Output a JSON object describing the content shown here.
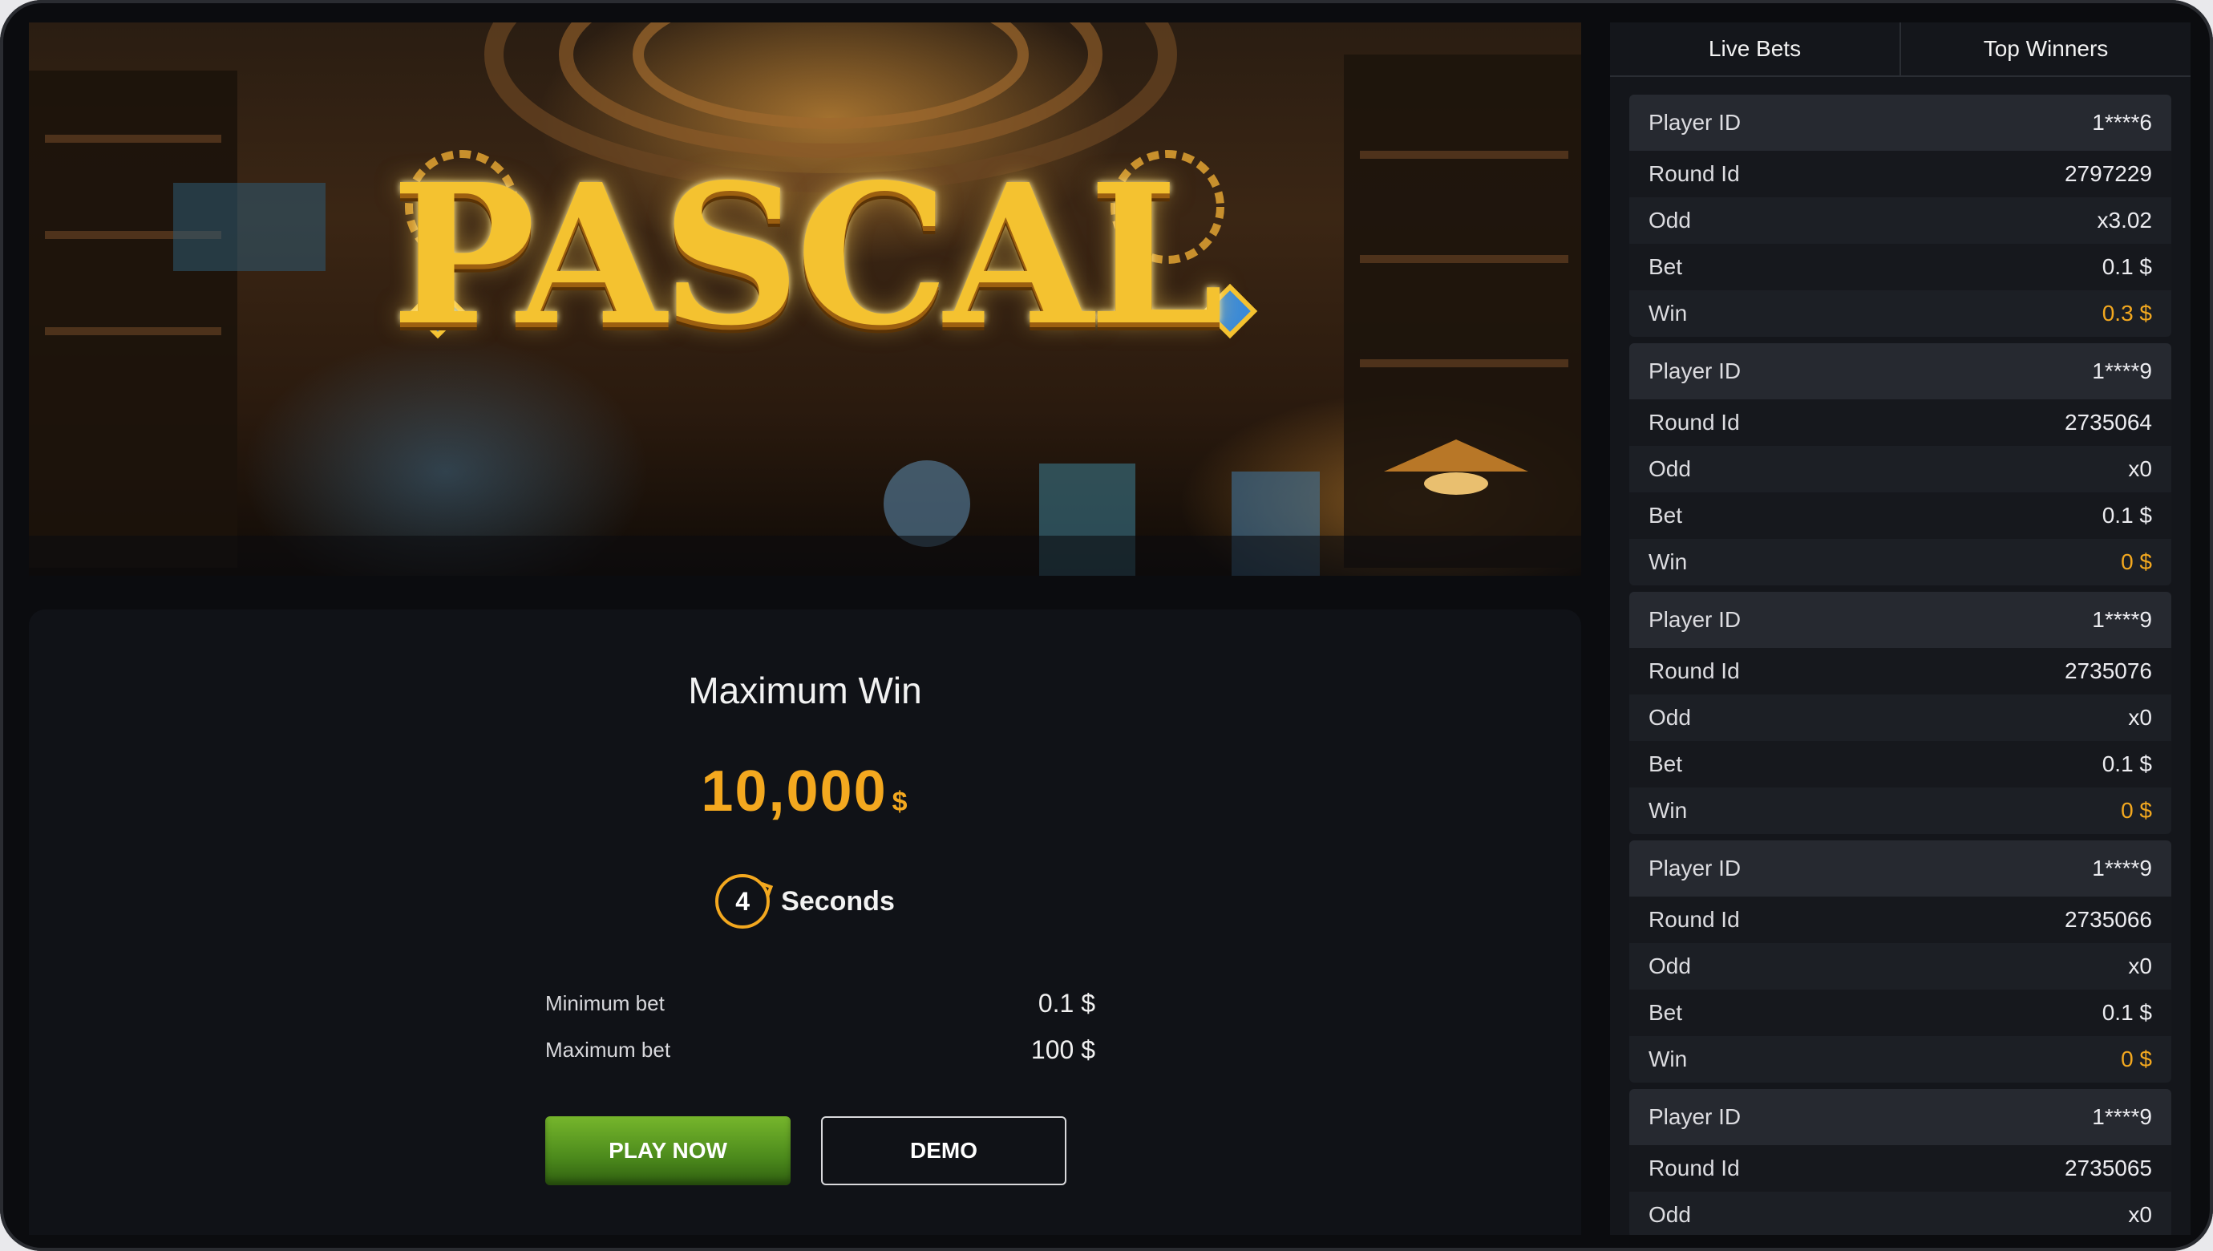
{
  "hero": {
    "logo_text": "PASCAL"
  },
  "game": {
    "max_win_title": "Maximum Win",
    "max_win_value": "10,000",
    "max_win_currency": "$",
    "timer_value": "4",
    "timer_label": "Seconds",
    "min_bet_label": "Minimum bet",
    "min_bet_value": "0.1 $",
    "max_bet_label": "Maximum bet",
    "max_bet_value": "100 $",
    "play_label": "PLAY NOW",
    "demo_label": "DEMO"
  },
  "sidebar": {
    "tabs": [
      "Live Bets",
      "Top Winners"
    ],
    "labels": {
      "player": "Player ID",
      "round": "Round Id",
      "odd": "Odd",
      "bet": "Bet",
      "win": "Win"
    },
    "bets": [
      {
        "player": "1****6",
        "round": "2797229",
        "odd": "x3.02",
        "bet": "0.1 $",
        "win": "0.3 $"
      },
      {
        "player": "1****9",
        "round": "2735064",
        "odd": "x0",
        "bet": "0.1 $",
        "win": "0 $"
      },
      {
        "player": "1****9",
        "round": "2735076",
        "odd": "x0",
        "bet": "0.1 $",
        "win": "0 $"
      },
      {
        "player": "1****9",
        "round": "2735066",
        "odd": "x0",
        "bet": "0.1 $",
        "win": "0 $"
      },
      {
        "player": "1****9",
        "round": "2735065",
        "odd": "x0",
        "bet": "",
        "win": ""
      }
    ]
  },
  "colors": {
    "accent": "#f3a81f",
    "play": "#5a9a22",
    "panel": "#101217",
    "sidebar": "#14161b"
  }
}
